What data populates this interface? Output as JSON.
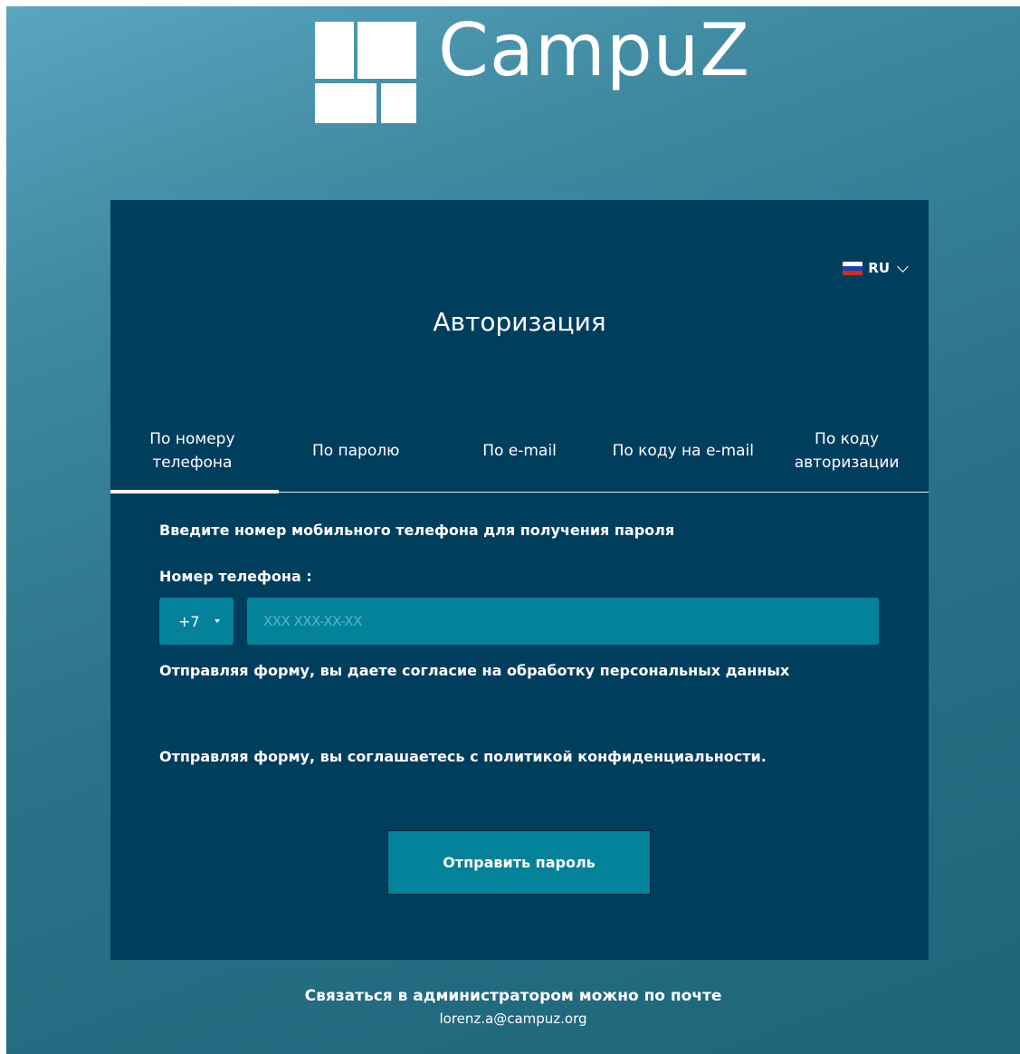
{
  "brand": {
    "name": "CampuZ"
  },
  "language": {
    "selected": "RU",
    "flag_colors": [
      "#ffffff",
      "#1f3fb5",
      "#d52b1e"
    ]
  },
  "auth": {
    "title": "Авторизация",
    "tabs": [
      {
        "label": "По номеру\nтелефона",
        "active": true
      },
      {
        "label": "По паролю",
        "active": false
      },
      {
        "label": "По e-mail",
        "active": false
      },
      {
        "label": "По коду на e-mail",
        "active": false
      },
      {
        "label": "По коду\nавторизации",
        "active": false
      }
    ],
    "hint": "Введите номер мобильного телефона для получения пароля",
    "phone_label": "Номер телефона :",
    "country_code": "+7",
    "phone_placeholder": "XXX XXX-XX-XX",
    "phone_value": "",
    "consent_text": "Отправляя форму, вы даете согласие на обработку персональных данных",
    "privacy_text": "Отправляя форму, вы соглашаетесь с политикой конфиденциальности.",
    "submit_label": "Отправить пароль"
  },
  "footer": {
    "contact_text": "Связаться в администратором можно по почте",
    "email": "lorenz.a@campuz.org"
  },
  "colors": {
    "card_bg": "#003e5e",
    "accent": "#03829a",
    "background_light": "#5aa6bf",
    "background_dark": "#1d6578"
  }
}
